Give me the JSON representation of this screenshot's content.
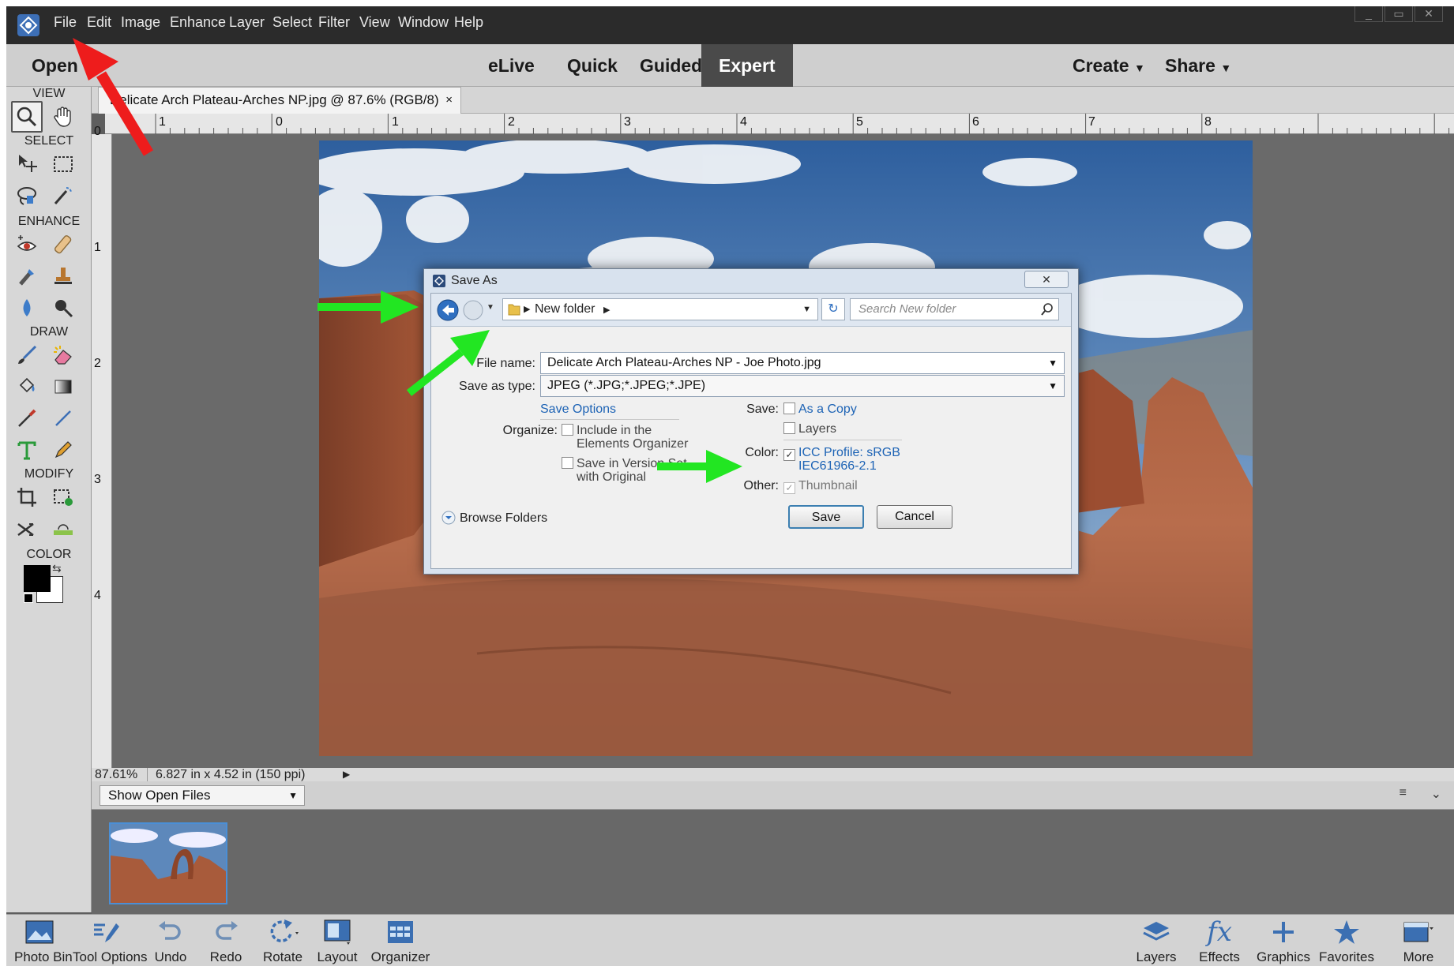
{
  "menubar": {
    "items": [
      "File",
      "Edit",
      "Image",
      "Enhance",
      "Layer",
      "Select",
      "Filter",
      "View",
      "Window",
      "Help"
    ]
  },
  "modebar": {
    "open": "Open",
    "modes": [
      "eLive",
      "Quick",
      "Guided",
      "Expert"
    ],
    "active_mode": "Expert",
    "create": "Create",
    "share": "Share"
  },
  "toolbox": {
    "sections": [
      "VIEW",
      "SELECT",
      "ENHANCE",
      "DRAW",
      "MODIFY",
      "COLOR"
    ]
  },
  "document": {
    "tab_title": "Delicate Arch Plateau-Arches NP.jpg @ 87.6% (RGB/8)",
    "tab_close": "×"
  },
  "rulers": {
    "horizontal": [
      "1",
      "0",
      "1",
      "2",
      "3",
      "4",
      "5",
      "6",
      "7",
      "8"
    ],
    "vertical": [
      "0",
      "1",
      "2",
      "3",
      "4"
    ]
  },
  "status": {
    "zoom": "87.61%",
    "doc_size": "6.827 in x 4.52 in (150 ppi)"
  },
  "bin": {
    "selector": "Show Open Files"
  },
  "dialog": {
    "title": "Save As",
    "close": "✕",
    "breadcrumb": "New folder",
    "search_placeholder": "Search New folder",
    "file_name_label": "File name:",
    "file_name_value": "Delicate Arch Plateau-Arches NP - Joe Photo.jpg",
    "save_as_type_label": "Save as type:",
    "save_as_type_value": "JPEG (*.JPG;*.JPEG;*.JPE)",
    "save_options": "Save Options",
    "organize_label": "Organize:",
    "include_organizer_1": "Include in the",
    "include_organizer_2": "Elements Organizer",
    "version_set_1": "Save in Version Set",
    "version_set_2": "with Original",
    "save_label": "Save:",
    "as_a_copy": "As a Copy",
    "layers": "Layers",
    "color_label": "Color:",
    "icc_profile_1": "ICC Profile: sRGB",
    "icc_profile_2": "IEC61966-2.1",
    "other_label": "Other:",
    "thumbnail": "Thumbnail",
    "browse_folders": "Browse Folders",
    "save_button": "Save",
    "cancel_button": "Cancel",
    "checked": {
      "as_a_copy": false,
      "layers": false,
      "icc_profile": true,
      "thumbnail": true,
      "include_organizer": false,
      "version_set": false
    }
  },
  "taskbar": {
    "left": [
      "Photo Bin",
      "Tool Options",
      "Undo",
      "Redo",
      "Rotate",
      "Layout",
      "Organizer"
    ],
    "right": [
      "Layers",
      "Effects",
      "Graphics",
      "Favorites",
      "More"
    ]
  },
  "colors": {
    "menubar_bg": "#2b2b2b",
    "annotation_red": "#ee1c1c",
    "annotation_green": "#22e622",
    "link_blue": "#1d63b5"
  }
}
